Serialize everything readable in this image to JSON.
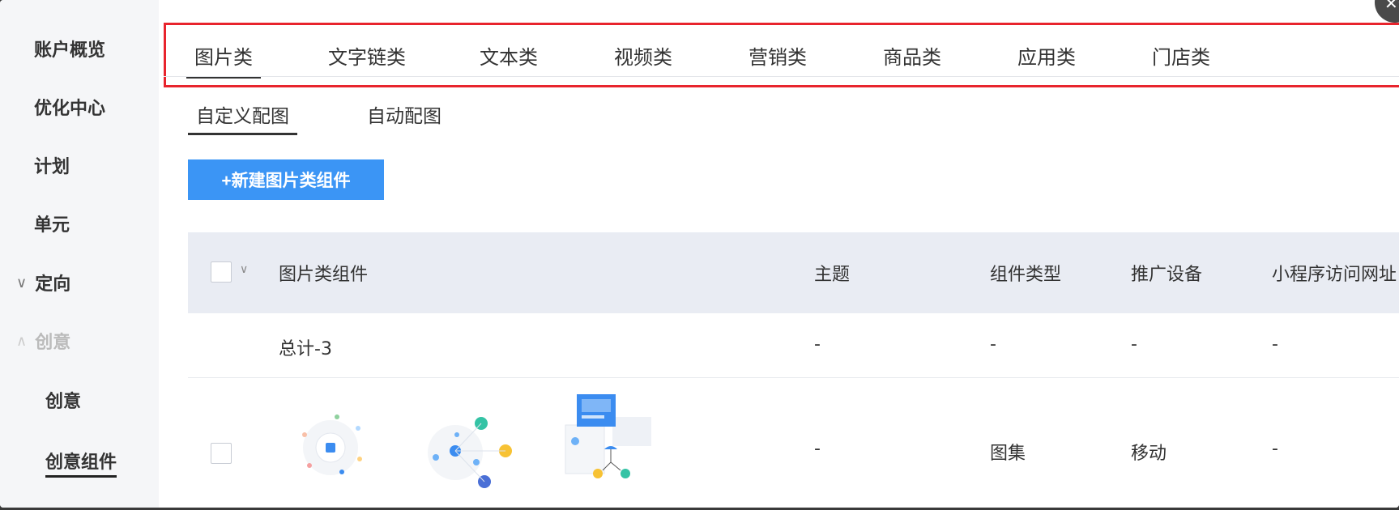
{
  "sidebar": {
    "items": [
      {
        "label": "账户概览"
      },
      {
        "label": "优化中心"
      },
      {
        "label": "计划"
      },
      {
        "label": "单元"
      },
      {
        "label": "定向",
        "chevron": "∨"
      },
      {
        "label": "创意",
        "chevron": "∧"
      },
      {
        "label": "创意"
      },
      {
        "label": "创意组件"
      }
    ]
  },
  "tabs": [
    "图片类",
    "文字链类",
    "文本类",
    "视频类",
    "营销类",
    "商品类",
    "应用类",
    "门店类"
  ],
  "subtabs": [
    "自定义配图",
    "自动配图"
  ],
  "new_button": "+新建图片类组件",
  "table": {
    "headers": [
      "图片类组件",
      "主题",
      "组件类型",
      "推广设备",
      "小程序访问网址"
    ],
    "total_row": {
      "label": "总计-3",
      "cells": [
        "-",
        "-",
        "-",
        "-"
      ]
    },
    "rows": [
      {
        "cells": [
          "-",
          "图集",
          "移动",
          "-"
        ]
      }
    ]
  },
  "colors": {
    "accent": "#3b95f5",
    "highlight_border": "#e8242d",
    "header_bg": "#e9ecf3",
    "sidebar_bg": "#f5f6f8"
  }
}
